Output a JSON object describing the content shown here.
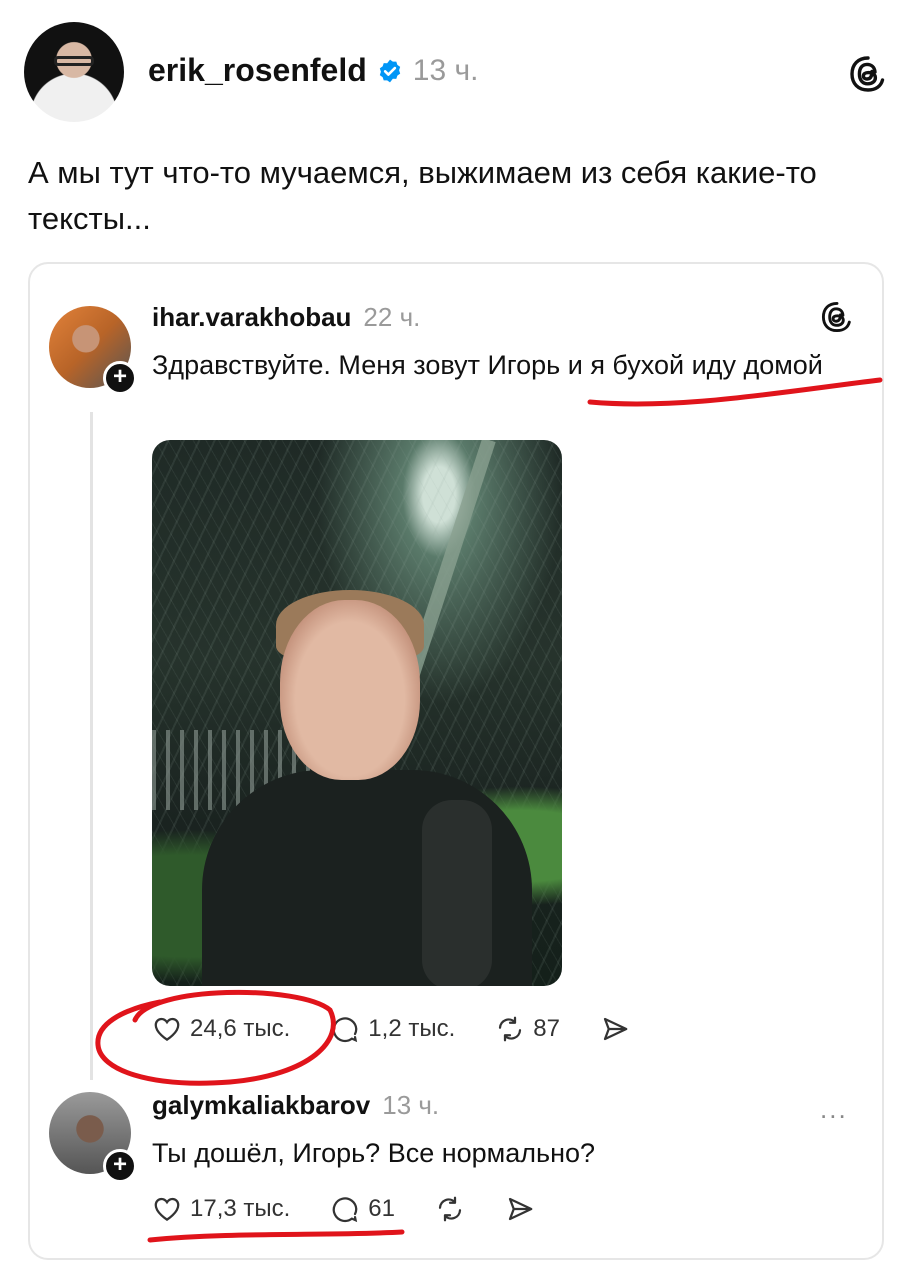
{
  "main_post": {
    "username": "erik_rosenfeld",
    "time": "13 ч.",
    "text": "А мы тут что-то мучаемся, выжимаем из себя какие-то тексты..."
  },
  "quoted_post": {
    "username": "ihar.varakhobau",
    "time": "22 ч.",
    "text": "Здравствуйте. Меня зовут Игорь и я бухой иду домой",
    "likes": "24,6 тыс.",
    "comments": "1,2 тыс.",
    "reposts": "87"
  },
  "reply": {
    "username": "galymkaliakbarov",
    "time": "13 ч.",
    "text": "Ты дошёл, Игорь? Все нормально?",
    "likes": "17,3 тыс.",
    "comments": "61",
    "more": "..."
  },
  "colors": {
    "annotation_red": "#e0141b",
    "verified_blue": "#0095f6"
  }
}
